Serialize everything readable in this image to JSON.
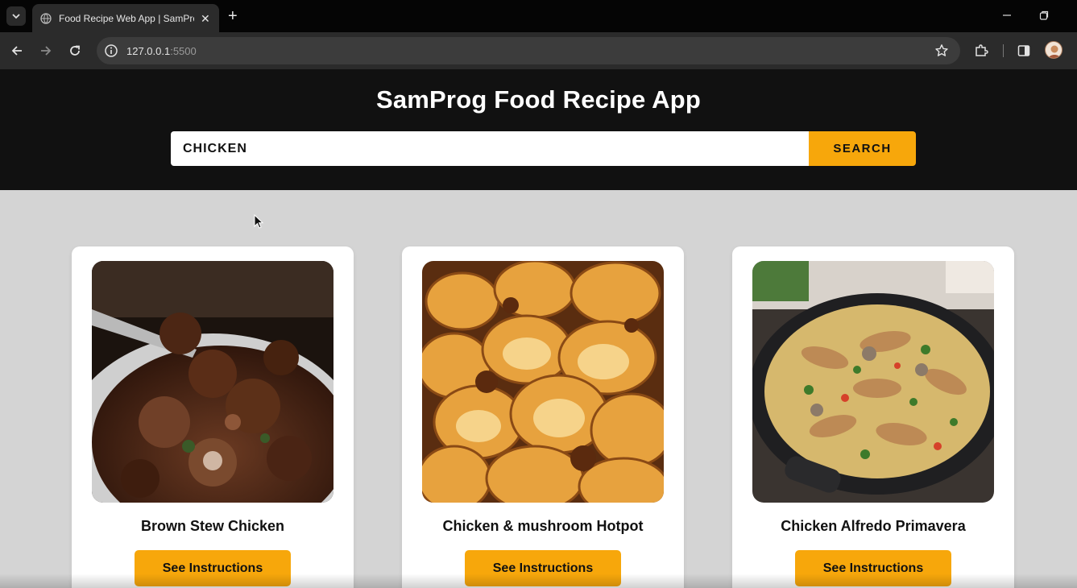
{
  "browser": {
    "tab_title": "Food Recipe Web App | SamProg",
    "url_host": "127.0.0.1",
    "url_port": ":5500"
  },
  "app": {
    "title": "SamProg Food Recipe App",
    "search_value": "CHICKEN",
    "search_button": "SEARCH",
    "accent_color": "#f7a70b",
    "header_color": "#111111",
    "background_color": "#d4d4d4"
  },
  "recipes": [
    {
      "name": "Brown Stew Chicken",
      "button": "See Instructions",
      "image": "brown-stew-chicken-photo"
    },
    {
      "name": "Chicken & mushroom Hotpot",
      "button": "See Instructions",
      "image": "chicken-mushroom-hotpot-photo"
    },
    {
      "name": "Chicken Alfredo Primavera",
      "button": "See Instructions",
      "image": "chicken-alfredo-primavera-photo"
    }
  ]
}
